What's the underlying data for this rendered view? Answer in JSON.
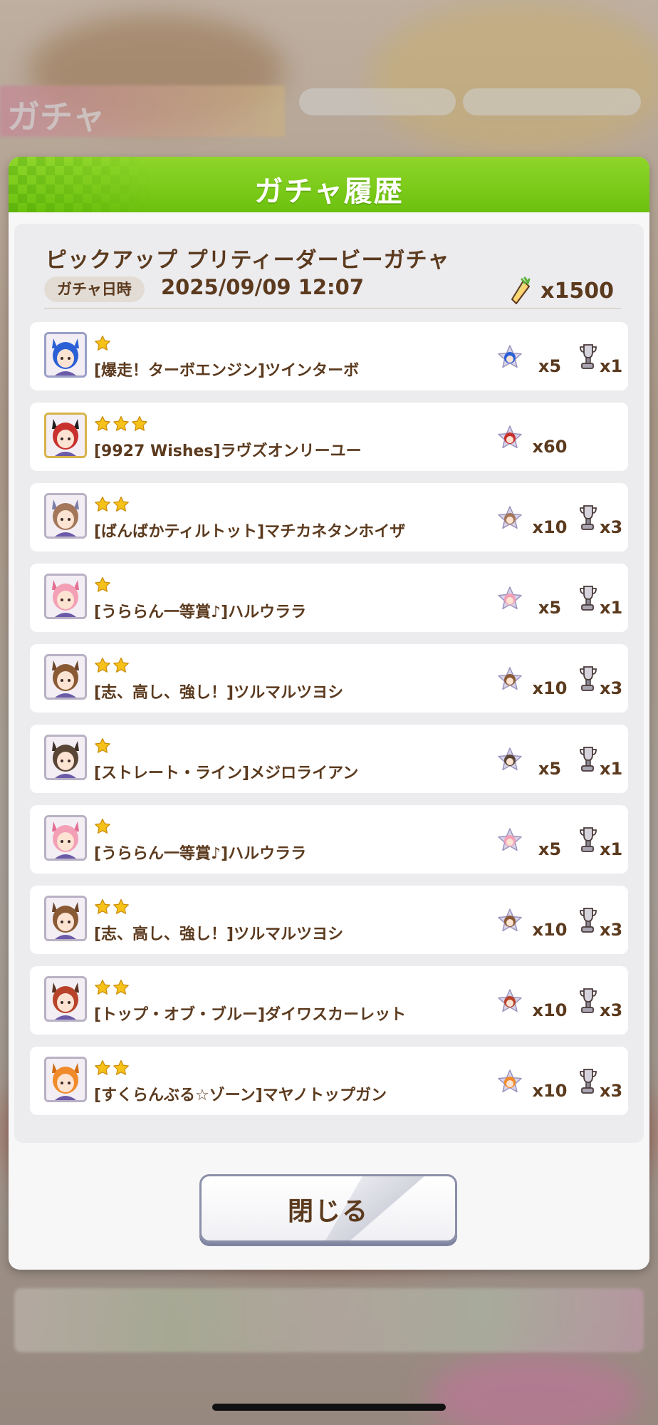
{
  "background": {
    "title": "ガチャ"
  },
  "dialog": {
    "title": "ガチャ履歴",
    "gacha_name": "ピックアップ プリティーダービーガチャ",
    "date_label": "ガチャ日時",
    "date_value": "2025/09/09 12:07",
    "cost_icon": "carrot-jewel-icon",
    "cost_value": "x1500",
    "close_label": "閉じる"
  },
  "results": [
    {
      "stars": 1,
      "name": "[爆走！ターボエンジン]ツインターボ",
      "pieces": "x5",
      "trophies": "x1",
      "hair": "#2b5fd6",
      "ear": "#2b5fd6",
      "frame": "#9aa0c8"
    },
    {
      "stars": 3,
      "name": "[9927 Wishes]ラヴズオンリーユー",
      "pieces": "x60",
      "trophies": "",
      "hair": "#c8312e",
      "ear": "#1d1d1d",
      "frame": "#d7b34a"
    },
    {
      "stars": 2,
      "name": "[ばんばかティルトット]マチカネタンホイザ",
      "pieces": "x10",
      "trophies": "x3",
      "hair": "#a4775a",
      "ear": "#7d7fa8",
      "frame": "#b9b1c4"
    },
    {
      "stars": 1,
      "name": "[うららん一等賞♪]ハルウララ",
      "pieces": "x5",
      "trophies": "x1",
      "hair": "#f3a0b6",
      "ear": "#e36f93",
      "frame": "#b9b1c4"
    },
    {
      "stars": 2,
      "name": "[志、高し、強し！]ツルマルツヨシ",
      "pieces": "x10",
      "trophies": "x3",
      "hair": "#8a5a35",
      "ear": "#6b4429",
      "frame": "#b9b1c4"
    },
    {
      "stars": 1,
      "name": "[ストレート・ライン]メジロライアン",
      "pieces": "x5",
      "trophies": "x1",
      "hair": "#5a4636",
      "ear": "#3e2f25",
      "frame": "#b9b1c4"
    },
    {
      "stars": 1,
      "name": "[うららん一等賞♪]ハルウララ",
      "pieces": "x5",
      "trophies": "x1",
      "hair": "#f3a0b6",
      "ear": "#e36f93",
      "frame": "#b9b1c4"
    },
    {
      "stars": 2,
      "name": "[志、高し、強し！]ツルマルツヨシ",
      "pieces": "x10",
      "trophies": "x3",
      "hair": "#8a5a35",
      "ear": "#6b4429",
      "frame": "#b9b1c4"
    },
    {
      "stars": 2,
      "name": "[トップ・オブ・ブルー]ダイワスカーレット",
      "pieces": "x10",
      "trophies": "x3",
      "hair": "#b8432a",
      "ear": "#5a3322",
      "frame": "#b9b1c4"
    },
    {
      "stars": 2,
      "name": "[すくらんぶる☆ゾーン]マヤノトップガン",
      "pieces": "x10",
      "trophies": "x3",
      "hair": "#f08a2a",
      "ear": "#d26b13",
      "frame": "#b9b1c4"
    }
  ],
  "icons": {
    "star": "star-icon",
    "piece": "character-piece-icon",
    "trophy": "trophy-icon",
    "portrait": "character-portrait-icon"
  },
  "colors": {
    "header_green": "#7ccb1a",
    "text_brown": "#5b3a1e",
    "star_gold": "#f6c21a"
  }
}
